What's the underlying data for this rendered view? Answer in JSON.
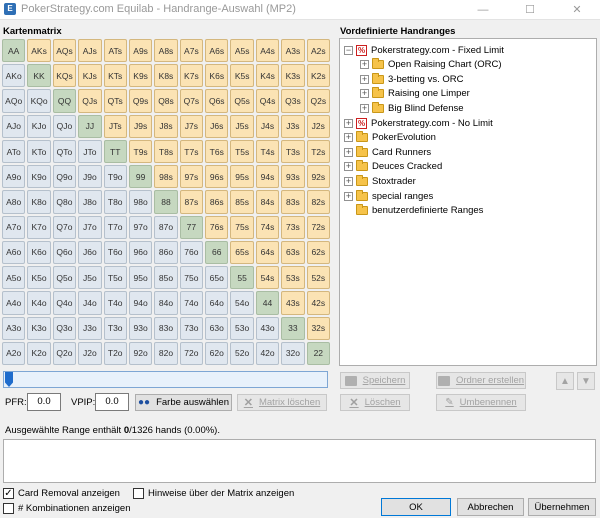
{
  "window": {
    "title": "PokerStrategy.com Equilab - Handrange-Auswahl (MP2)",
    "app_icon": "equilab-icon",
    "controls": {
      "minimize": "—",
      "maximize": "☐",
      "close": "✕"
    }
  },
  "matrix": {
    "label": "Kartenmatrix",
    "rows": [
      [
        "AA",
        "AKs",
        "AQs",
        "AJs",
        "ATs",
        "A9s",
        "A8s",
        "A7s",
        "A6s",
        "A5s",
        "A4s",
        "A3s",
        "A2s"
      ],
      [
        "AKo",
        "KK",
        "KQs",
        "KJs",
        "KTs",
        "K9s",
        "K8s",
        "K7s",
        "K6s",
        "K5s",
        "K4s",
        "K3s",
        "K2s"
      ],
      [
        "AQo",
        "KQo",
        "QQ",
        "QJs",
        "QTs",
        "Q9s",
        "Q8s",
        "Q7s",
        "Q6s",
        "Q5s",
        "Q4s",
        "Q3s",
        "Q2s"
      ],
      [
        "AJo",
        "KJo",
        "QJo",
        "JJ",
        "JTs",
        "J9s",
        "J8s",
        "J7s",
        "J6s",
        "J5s",
        "J4s",
        "J3s",
        "J2s"
      ],
      [
        "ATo",
        "KTo",
        "QTo",
        "JTo",
        "TT",
        "T9s",
        "T8s",
        "T7s",
        "T6s",
        "T5s",
        "T4s",
        "T3s",
        "T2s"
      ],
      [
        "A9o",
        "K9o",
        "Q9o",
        "J9o",
        "T9o",
        "99",
        "98s",
        "97s",
        "96s",
        "95s",
        "94s",
        "93s",
        "92s"
      ],
      [
        "A8o",
        "K8o",
        "Q8o",
        "J8o",
        "T8o",
        "98o",
        "88",
        "87s",
        "86s",
        "85s",
        "84s",
        "83s",
        "82s"
      ],
      [
        "A7o",
        "K7o",
        "Q7o",
        "J7o",
        "T7o",
        "97o",
        "87o",
        "77",
        "76s",
        "75s",
        "74s",
        "73s",
        "72s"
      ],
      [
        "A6o",
        "K6o",
        "Q6o",
        "J6o",
        "T6o",
        "96o",
        "86o",
        "76o",
        "66",
        "65s",
        "64s",
        "63s",
        "62s"
      ],
      [
        "A5o",
        "K5o",
        "Q5o",
        "J5o",
        "T5o",
        "95o",
        "85o",
        "75o",
        "65o",
        "55",
        "54s",
        "53s",
        "52s"
      ],
      [
        "A4o",
        "K4o",
        "Q4o",
        "J4o",
        "T4o",
        "94o",
        "84o",
        "74o",
        "64o",
        "54o",
        "44",
        "43s",
        "42s"
      ],
      [
        "A3o",
        "K3o",
        "Q3o",
        "J3o",
        "T3o",
        "93o",
        "83o",
        "73o",
        "63o",
        "53o",
        "43o",
        "33",
        "32s"
      ],
      [
        "A2o",
        "K2o",
        "Q2o",
        "J2o",
        "T2o",
        "92o",
        "82o",
        "72o",
        "62o",
        "52o",
        "42o",
        "32o",
        "22"
      ]
    ],
    "colors": {
      "pair": "#c6d8c0",
      "suited": "#fbe3b4",
      "offsuit": "#e0e7ef"
    }
  },
  "tree": {
    "label": "Vordefinierte Handranges",
    "nodes": [
      {
        "text": "Pokerstrategy.com - Fixed Limit",
        "expander": "⊟",
        "icon": "pokerstrategy-icon"
      },
      {
        "text": "Open Raising Chart (ORC)",
        "expander": "⊞",
        "icon": "folder-icon"
      },
      {
        "text": "3-betting vs. ORC",
        "expander": "⊞",
        "icon": "folder-icon"
      },
      {
        "text": "Raising one Limper",
        "expander": "⊞",
        "icon": "folder-icon"
      },
      {
        "text": "Big Blind Defense",
        "expander": "⊞",
        "icon": "folder-icon"
      },
      {
        "text": "Pokerstrategy.com - No Limit",
        "expander": "⊞",
        "icon": "pokerstrategy-icon"
      },
      {
        "text": "PokerEvolution",
        "expander": "⊞",
        "icon": "folder-icon"
      },
      {
        "text": "Card Runners",
        "expander": "⊞",
        "icon": "folder-icon"
      },
      {
        "text": "Deuces Cracked",
        "expander": "⊞",
        "icon": "folder-icon"
      },
      {
        "text": "Stoxtrader",
        "expander": "⊞",
        "icon": "folder-icon"
      },
      {
        "text": "special ranges",
        "expander": "⊞",
        "icon": "folder-icon"
      },
      {
        "text": "benutzerdefinierte Ranges",
        "expander": "",
        "icon": "user-folder-icon"
      }
    ]
  },
  "controls": {
    "slider_value": 0,
    "pfr_label": "PFR:",
    "pfr_value": "0.0",
    "vpip_label": "VPIP:",
    "vpip_value": "0.0",
    "farbe_button": "Farbe auswählen",
    "matrix_loeschen": "Matrix löschen",
    "speichern": "Speichern",
    "loeschen": "Löschen",
    "ordner_erstellen": "Ordner erstellen",
    "umbenennen": "Umbenennen",
    "move_up": "▲",
    "move_down": "▼"
  },
  "status": {
    "prefix": "Ausgewählte Range enthält ",
    "count": "0",
    "suffix": "/1326 hands (0.00%)."
  },
  "checkboxes": {
    "card_removal": {
      "label": "Card Removal anzeigen",
      "checked": true,
      "mark": "✓"
    },
    "hinweise": {
      "label": "Hinweise über der Matrix anzeigen",
      "checked": false,
      "mark": ""
    },
    "kombinationen": {
      "label": "# Kombinationen anzeigen",
      "checked": false,
      "mark": ""
    }
  },
  "footer": {
    "ok": "OK",
    "abbrechen": "Abbrechen",
    "uebernehmen": "Übernehmen"
  }
}
